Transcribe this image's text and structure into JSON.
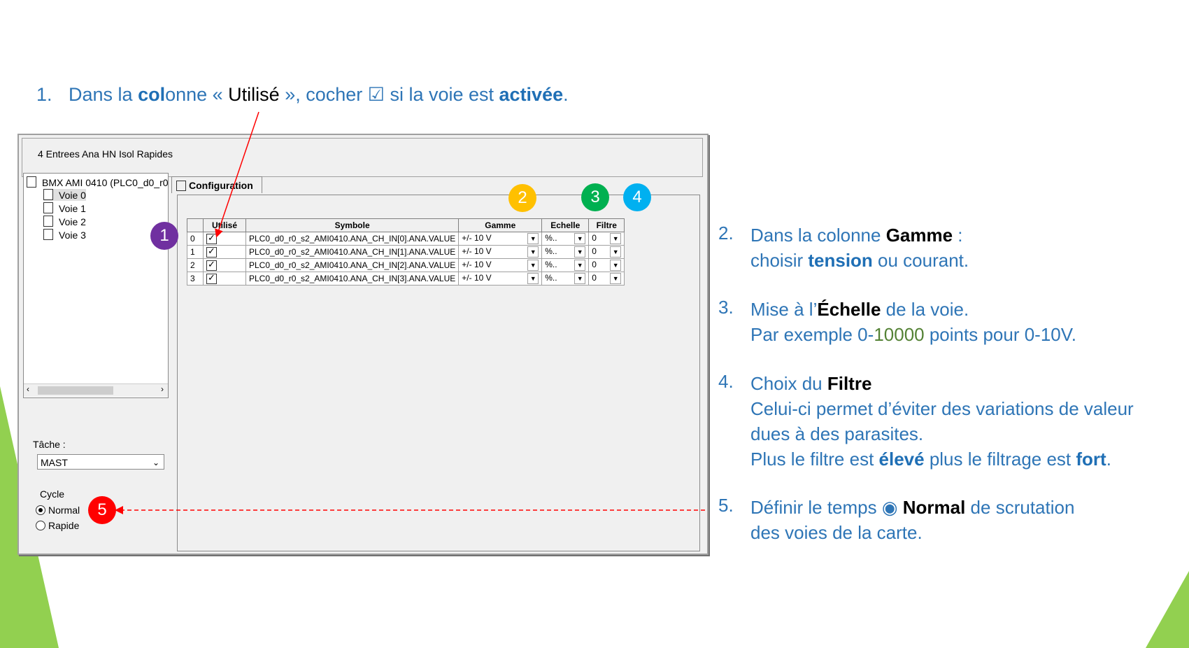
{
  "step1": {
    "num": "1.",
    "p1": "Dans la ",
    "b1": "col",
    "p2": "onne « ",
    "k1": "Utilisé",
    "p3": " », cocher ☑ si la voie est ",
    "b2": "activée",
    "p4": "."
  },
  "step2": {
    "num": "2.",
    "l1a": "Dans la colonne ",
    "l1b": "Gamme",
    "l1c": " :",
    "l2a": "choisir ",
    "l2b": "tension",
    "l2c": " ou courant."
  },
  "step3": {
    "num": "3.",
    "l1a": "Mise à l’",
    "l1b": "Échelle",
    "l1c": " de la voie.",
    "l2a": "Par exemple 0-",
    "l2b": "10000",
    "l2c": " points pour 0-10V."
  },
  "step4": {
    "num": "4.",
    "l1a": "Choix du ",
    "l1b": "Filtre",
    "l2": "Celui-ci permet d’éviter des variations de valeur",
    "l3": "dues à des parasites.",
    "l4a": "Plus le filtre est ",
    "l4b": "élevé",
    "l4c": " plus le filtrage est ",
    "l4d": "fort",
    "l4e": "."
  },
  "step5": {
    "num": "5.",
    "l1a": "Définir le temps ◉ ",
    "l1b": "Normal",
    "l1c": " de scrutation",
    "l2": "des voies de la carte."
  },
  "window": {
    "title": "4 Entrees Ana HN Isol Rapides",
    "tree_root": "BMX AMI 0410 (PLC0_d0_r0",
    "tree_items": [
      "Voie 0",
      "Voie 1",
      "Voie 2",
      "Voie 3"
    ],
    "tab_label": "Configuration",
    "tache_label": "Tâche :",
    "tache_value": "MAST",
    "cycle_label": "Cycle",
    "cycle_normal": "Normal",
    "cycle_rapide": "Rapide"
  },
  "grid": {
    "headers": [
      "",
      "Utilisé",
      "Symbole",
      "Gamme",
      "Echelle",
      "Filtre"
    ],
    "rows": [
      {
        "idx": "0",
        "symbole": "PLC0_d0_r0_s2_AMI0410.ANA_CH_IN[0].ANA.VALUE",
        "gamme": "+/- 10 V",
        "echelle": "%..",
        "filtre": "0"
      },
      {
        "idx": "1",
        "symbole": "PLC0_d0_r0_s2_AMI0410.ANA_CH_IN[1].ANA.VALUE",
        "gamme": "+/- 10 V",
        "echelle": "%..",
        "filtre": "0"
      },
      {
        "idx": "2",
        "symbole": "PLC0_d0_r0_s2_AMI0410.ANA_CH_IN[2].ANA.VALUE",
        "gamme": "+/- 10 V",
        "echelle": "%..",
        "filtre": "0"
      },
      {
        "idx": "3",
        "symbole": "PLC0_d0_r0_s2_AMI0410.ANA_CH_IN[3].ANA.VALUE",
        "gamme": "+/- 10 V",
        "echelle": "%..",
        "filtre": "0"
      }
    ]
  },
  "badges": [
    {
      "label": "1",
      "color": "#7030a0"
    },
    {
      "label": "2",
      "color": "#ffc000"
    },
    {
      "label": "3",
      "color": "#00b050"
    },
    {
      "label": "4",
      "color": "#00b0f0"
    },
    {
      "label": "5",
      "color": "#ff0000"
    }
  ],
  "colors": {
    "text_blue": "#2e75b6",
    "accent_green": "#92d050",
    "arrow_red": "#ff0000"
  }
}
